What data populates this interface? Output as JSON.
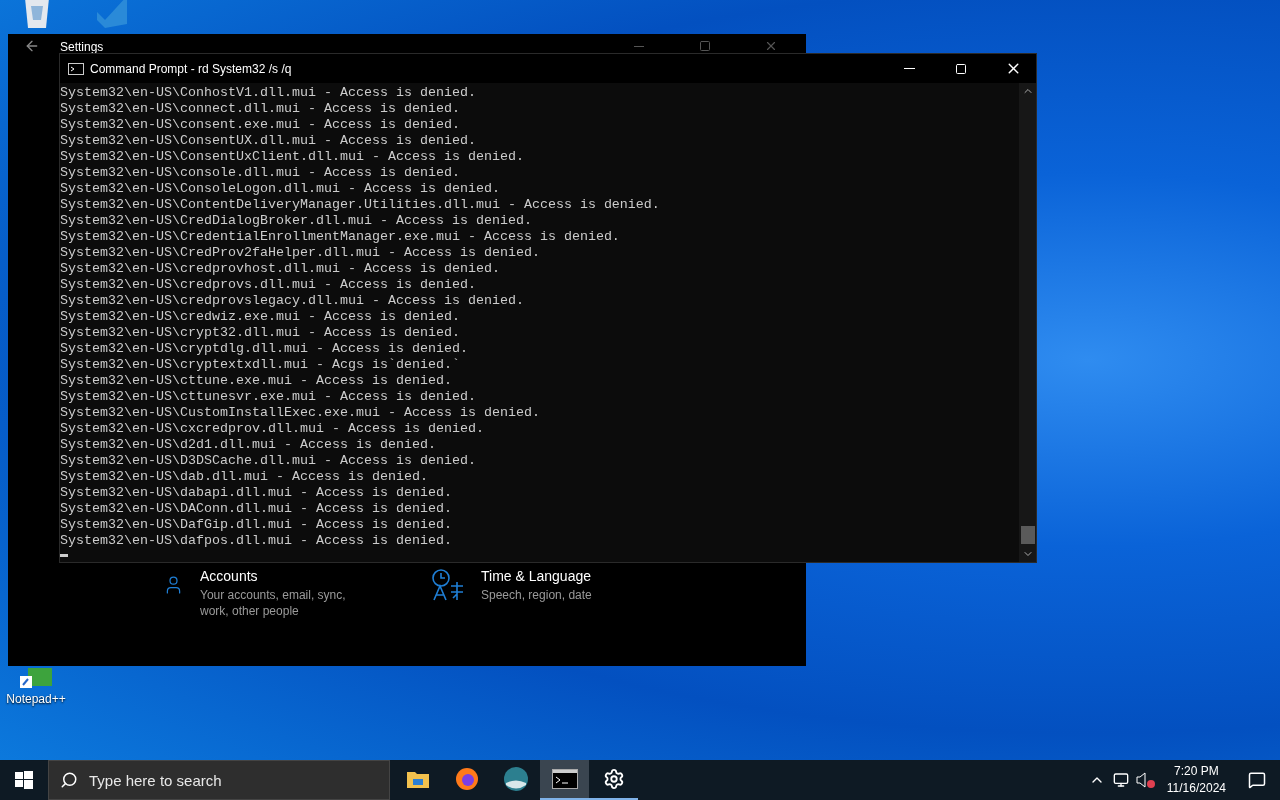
{
  "desktop_icons": [
    {
      "kind": "recycle"
    },
    {
      "kind": "editor"
    },
    {
      "kind": "notepad",
      "label": "Notepad++"
    }
  ],
  "settings_window": {
    "title": "Settings",
    "items": [
      {
        "kind": "accounts",
        "title": "Accounts",
        "description": "Your accounts, email, sync, work, other people"
      },
      {
        "kind": "time",
        "title": "Time & Language",
        "description": "Speech, region, date"
      }
    ]
  },
  "cmd_window": {
    "title": "Command Prompt - rd  System32 /s /q",
    "lines": [
      "System32\\en-US\\ConhostV1.dll.mui - Access is denied.",
      "System32\\en-US\\connect.dll.mui - Access is denied.",
      "System32\\en-US\\consent.exe.mui - Access is denied.",
      "System32\\en-US\\ConsentUX.dll.mui - Access is denied.",
      "System32\\en-US\\ConsentUxClient.dll.mui - Access is denied.",
      "System32\\en-US\\console.dll.mui - Access is denied.",
      "System32\\en-US\\ConsoleLogon.dll.mui - Access is denied.",
      "System32\\en-US\\ContentDeliveryManager.Utilities.dll.mui - Access is denied.",
      "System32\\en-US\\CredDialogBroker.dll.mui - Access is denied.",
      "System32\\en-US\\CredentialEnrollmentManager.exe.mui - Access is denied.",
      "System32\\en-US\\CredProv2faHelper.dll.mui - Access is denied.",
      "System32\\en-US\\credprovhost.dll.mui - Access is denied.",
      "System32\\en-US\\credprovs.dll.mui - Access is denied.",
      "System32\\en-US\\credprovslegacy.dll.mui - Access is denied.",
      "System32\\en-US\\credwiz.exe.mui - Access is denied.",
      "System32\\en-US\\crypt32.dll.mui - Access is denied.",
      "System32\\en-US\\cryptdlg.dll.mui - Access is denied.",
      "System32\\en-US\\cryptextxdll.mui - Acgs is`denied.`",
      "System32\\en-US\\cttune.exe.mui - Access is denied.",
      "System32\\en-US\\cttunesvr.exe.mui - Access is denied.",
      "System32\\en-US\\CustomInstallExec.exe.mui - Access is denied.",
      "System32\\en-US\\cxcredprov.dll.mui - Access is denied.",
      "System32\\en-US\\d2d1.dll.mui - Access is denied.",
      "System32\\en-US\\D3DSCache.dll.mui - Access is denied.",
      "System32\\en-US\\dab.dll.mui - Access is denied.",
      "System32\\en-US\\dabapi.dll.mui - Access is denied.",
      "System32\\en-US\\DAConn.dll.mui - Access is denied.",
      "System32\\en-US\\DafGip.dll.mui - Access is denied.",
      "System32\\en-US\\dafpos.dll.mui - Access is denied."
    ]
  },
  "taskbar": {
    "search": {
      "placeholder": "Type here to search"
    },
    "apps": [
      {
        "kind": "files",
        "selected": false,
        "running": false
      },
      {
        "kind": "browser",
        "selected": false,
        "running": false
      },
      {
        "kind": "globe",
        "selected": false,
        "running": false
      },
      {
        "kind": "terminal",
        "selected": true,
        "running": true
      },
      {
        "kind": "settings",
        "selected": false,
        "running": true
      }
    ],
    "time": "7:20 PM",
    "date": "11/16/2024"
  }
}
